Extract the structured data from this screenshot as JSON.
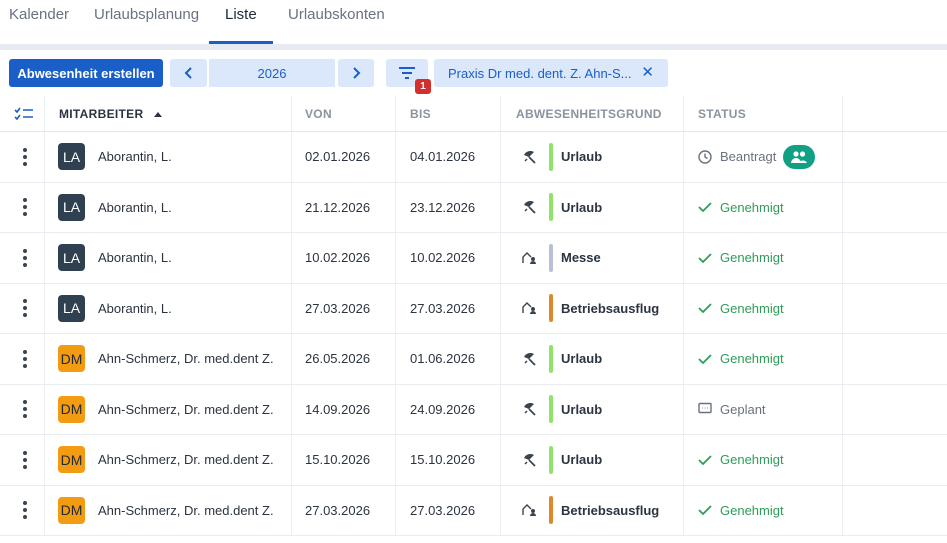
{
  "tabs": [
    {
      "label": "Kalender"
    },
    {
      "label": "Urlaubsplanung"
    },
    {
      "label": "Liste"
    },
    {
      "label": "Urlaubskonten"
    }
  ],
  "active_tab": "Liste",
  "toolbar": {
    "create_label": "Abwesenheit erstellen",
    "year": "2026",
    "filter_count": "1",
    "chip_label": "Praxis Dr med. dent. Z. Ahn-S..."
  },
  "columns": {
    "mitarbeiter": "MITARBEITER",
    "von": "VON",
    "bis": "BIS",
    "grund": "ABWESENHEITSGRUND",
    "status": "STATUS"
  },
  "colors": {
    "primary": "#1a5fc7",
    "urlaub": "#8fe36a",
    "messe": "#b8bfd6",
    "betriebsausflug": "#e0892a",
    "genehmigt": "#2e9d5a",
    "team_badge": "#12a085"
  },
  "rows": [
    {
      "initials": "LA",
      "name": "Aborantin, L.",
      "von": "02.01.2026",
      "bis": "04.01.2026",
      "grund": "Urlaub",
      "status": "Beantragt"
    },
    {
      "initials": "LA",
      "name": "Aborantin, L.",
      "von": "21.12.2026",
      "bis": "23.12.2026",
      "grund": "Urlaub",
      "status": "Genehmigt"
    },
    {
      "initials": "LA",
      "name": "Aborantin, L.",
      "von": "10.02.2026",
      "bis": "10.02.2026",
      "grund": "Messe",
      "status": "Genehmigt"
    },
    {
      "initials": "LA",
      "name": "Aborantin, L.",
      "von": "27.03.2026",
      "bis": "27.03.2026",
      "grund": "Betriebsausflug",
      "status": "Genehmigt"
    },
    {
      "initials": "DM",
      "name": "Ahn-Schmerz, Dr. med.dent Z.",
      "von": "26.05.2026",
      "bis": "01.06.2026",
      "grund": "Urlaub",
      "status": "Genehmigt"
    },
    {
      "initials": "DM",
      "name": "Ahn-Schmerz, Dr. med.dent Z.",
      "von": "14.09.2026",
      "bis": "24.09.2026",
      "grund": "Urlaub",
      "status": "Geplant"
    },
    {
      "initials": "DM",
      "name": "Ahn-Schmerz, Dr. med.dent Z.",
      "von": "15.10.2026",
      "bis": "15.10.2026",
      "grund": "Urlaub",
      "status": "Genehmigt"
    },
    {
      "initials": "DM",
      "name": "Ahn-Schmerz, Dr. med.dent Z.",
      "von": "27.03.2026",
      "bis": "27.03.2026",
      "grund": "Betriebsausflug",
      "status": "Genehmigt"
    }
  ]
}
